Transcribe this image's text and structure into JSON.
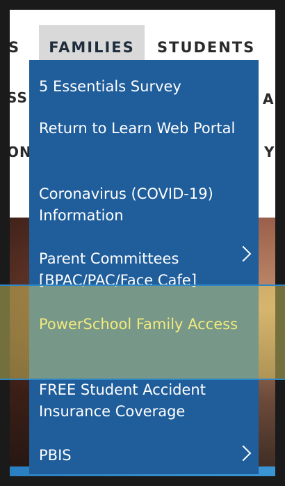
{
  "nav": {
    "left_tab_fragment": "S",
    "families_tab": "FAMILIES",
    "students_tab": "STUDENTS",
    "sub_left_1": "SS",
    "sub_left_2": "ON",
    "sub_right_1": "A",
    "sub_right_2": "Y"
  },
  "dropdown": {
    "items": [
      {
        "label": "5 Essentials Survey",
        "has_submenu": false
      },
      {
        "label": "Return to Learn Web Portal",
        "has_submenu": false
      },
      {
        "label": "Coronavirus (COVID-19) Information",
        "has_submenu": false
      },
      {
        "label": "Parent Committees [BPAC/PAC/Face Cafe]",
        "has_submenu": true
      },
      {
        "label": "PowerSchool Family Access",
        "has_submenu": false,
        "highlighted": true
      },
      {
        "label": "FREE Student Accident Insurance Coverage",
        "has_submenu": false
      },
      {
        "label": "PBIS",
        "has_submenu": true
      }
    ]
  },
  "colors": {
    "menu_bg": "#1f5d9b",
    "highlight": "#f0e66e",
    "highlight_border": "#2f86c6"
  }
}
